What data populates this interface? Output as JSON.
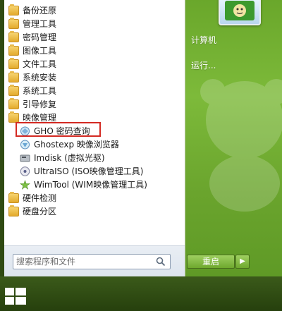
{
  "menu": {
    "items": [
      {
        "label": "备份还原",
        "icon": "folder-icon"
      },
      {
        "label": "管理工具",
        "icon": "folder-icon"
      },
      {
        "label": "密码管理",
        "icon": "folder-icon"
      },
      {
        "label": "图像工具",
        "icon": "folder-icon"
      },
      {
        "label": "文件工具",
        "icon": "folder-icon"
      },
      {
        "label": "系统安装",
        "icon": "folder-icon"
      },
      {
        "label": "系统工具",
        "icon": "folder-icon"
      },
      {
        "label": "引导修复",
        "icon": "folder-icon"
      },
      {
        "label": "映像管理",
        "icon": "folder-icon"
      },
      {
        "label": "GHO 密码查询",
        "icon": "gho-icon",
        "highlighted": true
      },
      {
        "label": "Ghostexp 映像浏览器",
        "icon": "ghostexp-icon"
      },
      {
        "label": "Imdisk (虚拟光驱)",
        "icon": "imdisk-icon"
      },
      {
        "label": "UltraISO (ISO映像管理工具)",
        "icon": "ultraiso-icon"
      },
      {
        "label": "WimTool (WIM映像管理工具)",
        "icon": "wimtool-icon"
      },
      {
        "label": "硬件检测",
        "icon": "folder-icon"
      },
      {
        "label": "硬盘分区",
        "icon": "folder-icon"
      }
    ]
  },
  "right_pane": {
    "computer_label": "计算机",
    "run_label": "运行..."
  },
  "search": {
    "placeholder": "搜索程序和文件"
  },
  "power": {
    "restart_label": "重启",
    "arrow_glyph": "▶"
  },
  "colors": {
    "accent_green": "#7dba3a",
    "highlight_border": "#d42a23"
  }
}
